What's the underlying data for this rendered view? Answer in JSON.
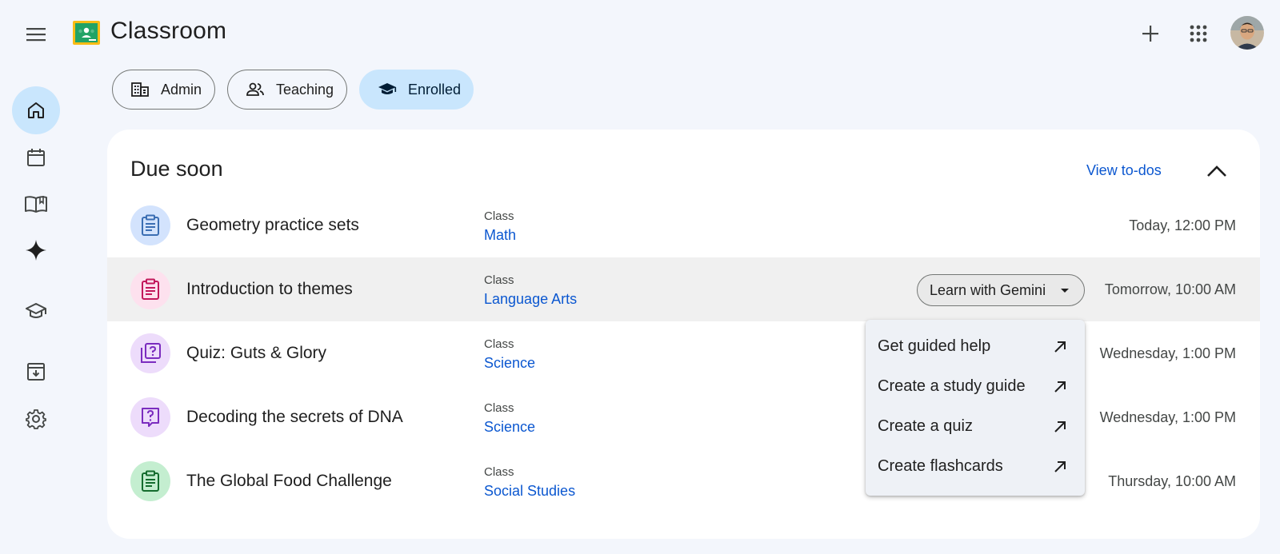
{
  "app": {
    "title": "Classroom"
  },
  "filters": [
    {
      "label": "Admin",
      "selected": false
    },
    {
      "label": "Teaching",
      "selected": false
    },
    {
      "label": "Enrolled",
      "selected": true
    }
  ],
  "due_soon": {
    "title": "Due soon",
    "view_todos_label": "View to-dos",
    "items": [
      {
        "title": "Geometry practice sets",
        "class_label": "Class",
        "class_name": "Math",
        "due": "Today, 12:00 PM",
        "icon": "assignment-icon",
        "color": "#d3e3fd"
      },
      {
        "title": "Introduction to themes",
        "class_label": "Class",
        "class_name": "Language Arts",
        "due": "Tomorrow, 10:00 AM",
        "icon": "assignment-icon",
        "color": "#fde1ee"
      },
      {
        "title": "Quiz: Guts & Glory",
        "class_label": "Class",
        "class_name": "Science",
        "due": "Wednesday, 1:00 PM",
        "icon": "quiz-icon",
        "color": "#eddcfb"
      },
      {
        "title": "Decoding the secrets of DNA",
        "class_label": "Class",
        "class_name": "Science",
        "due": "Wednesday, 1:00 PM",
        "icon": "question-icon",
        "color": "#eddcfb"
      },
      {
        "title": "The Global Food Challenge",
        "class_label": "Class",
        "class_name": "Social Studies",
        "due": "Thursday, 10:00 AM",
        "icon": "assignment-icon",
        "color": "#c4eed0"
      }
    ]
  },
  "gemini": {
    "button_label": "Learn with Gemini",
    "menu": [
      {
        "label": "Get guided help"
      },
      {
        "label": "Create a study guide"
      },
      {
        "label": "Create a quiz"
      },
      {
        "label": "Create flashcards"
      }
    ]
  },
  "colors": {
    "accent": "#0b57d0",
    "chip_selected": "#c9e6fd",
    "background": "#f3f6fc"
  }
}
